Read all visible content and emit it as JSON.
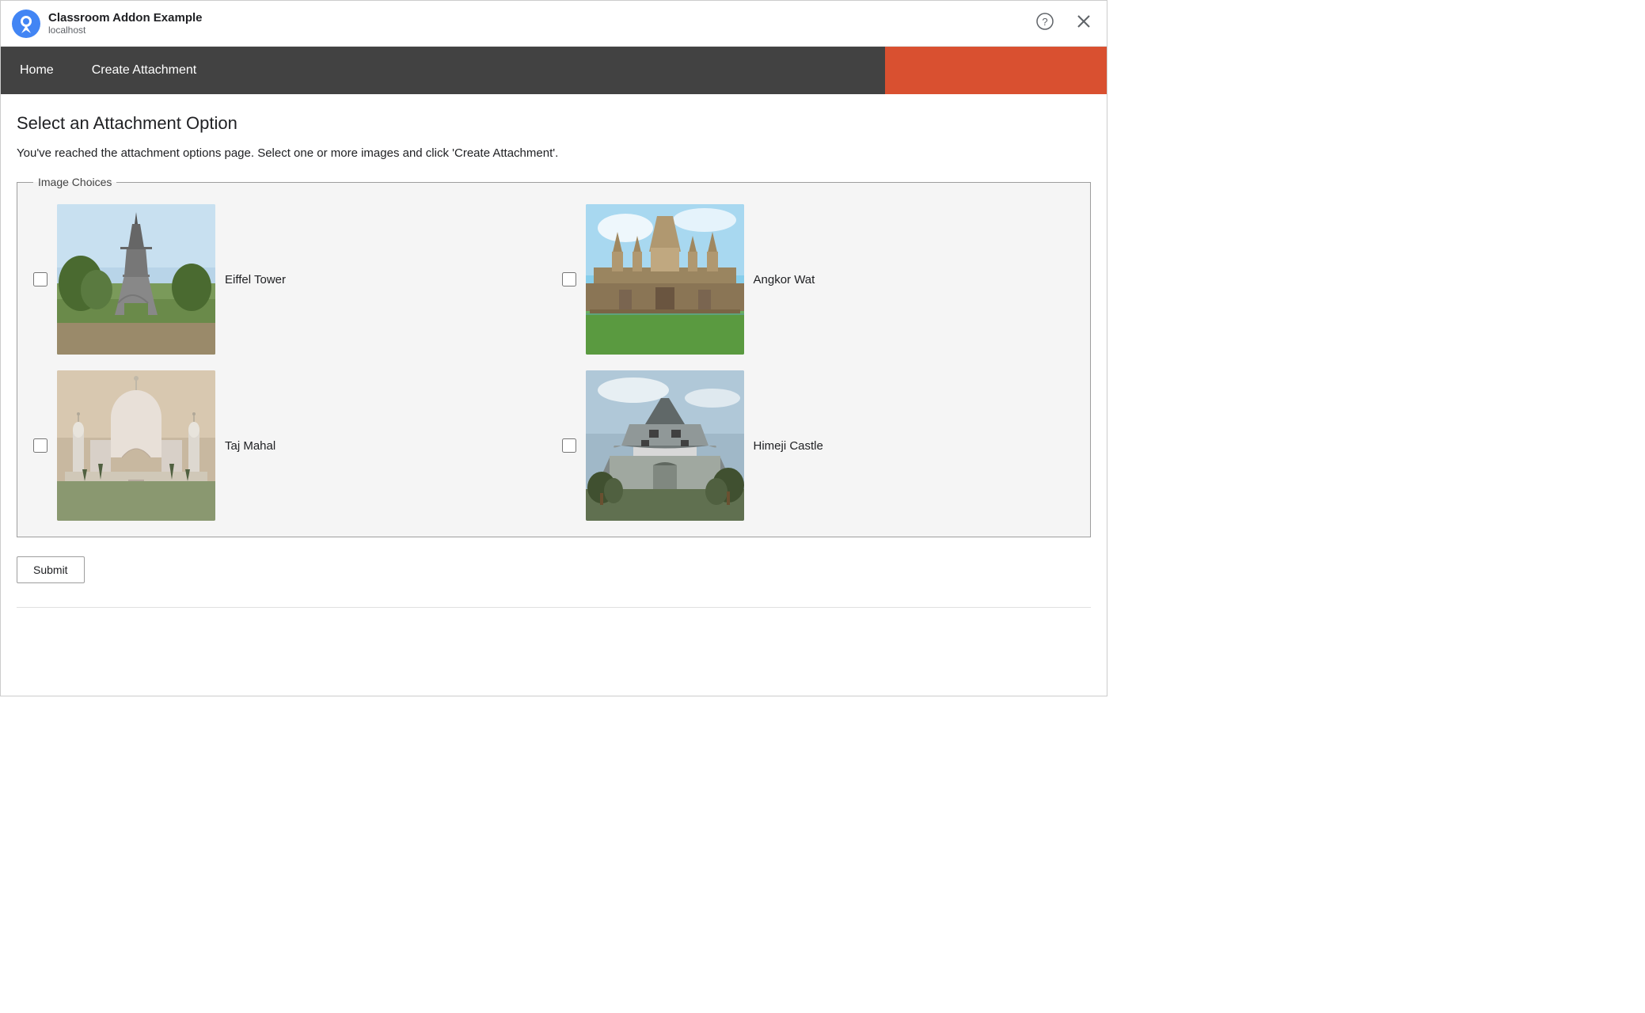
{
  "titleBar": {
    "appTitle": "Classroom Addon Example",
    "appUrl": "localhost",
    "helpLabel": "?",
    "closeLabel": "×"
  },
  "navBar": {
    "homeLabel": "Home",
    "createAttachmentLabel": "Create Attachment"
  },
  "content": {
    "pageTitle": "Select an Attachment Option",
    "pageDescription": "You've reached the attachment options page. Select one or more images and click 'Create Attachment'.",
    "fieldsetLegend": "Image Choices",
    "images": [
      {
        "id": "eiffel",
        "label": "Eiffel Tower"
      },
      {
        "id": "angkor",
        "label": "Angkor Wat"
      },
      {
        "id": "taj",
        "label": "Taj Mahal"
      },
      {
        "id": "himeji",
        "label": "Himeji Castle"
      }
    ],
    "submitLabel": "Submit"
  }
}
